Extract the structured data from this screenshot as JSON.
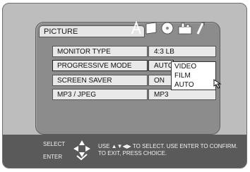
{
  "menu": {
    "tab_label": "PICTURE",
    "tab_icons": [
      "audio-icon",
      "display-icon",
      "disc-icon",
      "parental-icon",
      "setup-wrench-icon"
    ]
  },
  "settings": [
    {
      "label": "MONITOR TYPE",
      "value": "4:3 LB"
    },
    {
      "label": "PROGRESSIVE MODE",
      "value": "AUTO"
    },
    {
      "label": "SCREEN SAVER",
      "value": "ON"
    },
    {
      "label": "MP3 / JPEG",
      "value": "MP3"
    }
  ],
  "dropdown": {
    "options": [
      "VIDEO",
      "FILM",
      "AUTO"
    ],
    "selected": "AUTO"
  },
  "footer": {
    "select_label": "SELECT",
    "enter_label": "ENTER",
    "instruction_line1": "USE ▲▼◀▶ TO SELECT.  USE ENTER TO CONFIRM.",
    "instruction_line2": "TO EXIT, PRESS CHOICE."
  }
}
